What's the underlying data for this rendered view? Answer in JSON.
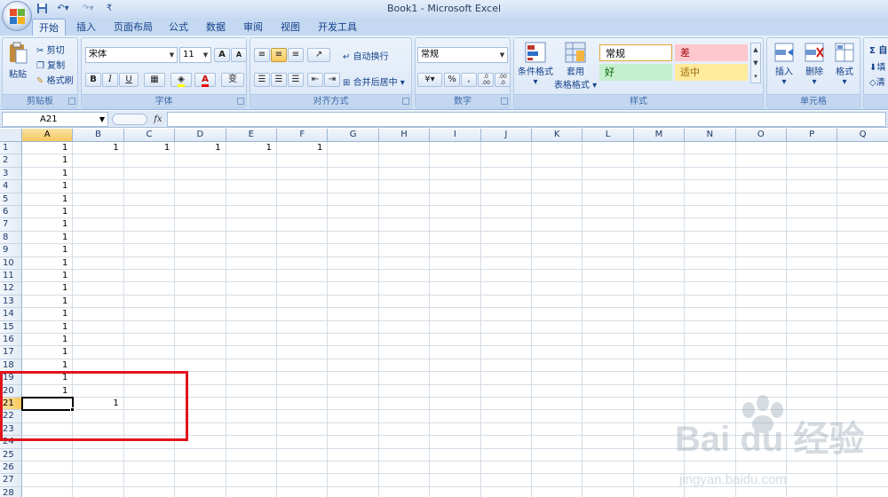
{
  "window": {
    "title": "Book1 - Microsoft Excel"
  },
  "qat": [
    "save-icon",
    "undo-icon",
    "redo-icon",
    "customize-icon"
  ],
  "tabs": [
    "开始",
    "插入",
    "页面布局",
    "公式",
    "数据",
    "审阅",
    "视图",
    "开发工具"
  ],
  "active_tab": "开始",
  "ribbon": {
    "clipboard": {
      "label": "剪贴板",
      "paste": "粘贴",
      "cut": "剪切",
      "copy": "复制",
      "format_painter": "格式刷"
    },
    "font": {
      "label": "字体",
      "font_name": "宋体",
      "font_size": "11",
      "bold": "B",
      "italic": "I",
      "underline": "U",
      "grow": "A",
      "shrink": "A",
      "phonetic": "变",
      "font_color": "A"
    },
    "alignment": {
      "label": "对齐方式",
      "wrap_text": "自动换行",
      "merge_center": "合并后居中"
    },
    "number": {
      "label": "数字",
      "format": "常规",
      "percent": "%",
      "comma": ",",
      "inc_decimal": ".0 .00",
      "dec_decimal": ".00 .0"
    },
    "styles": {
      "label": "样式",
      "conditional": "条件格式",
      "table_line1": "套用",
      "table_line2": "表格格式",
      "cell_normal": "常规",
      "cell_bad": "差",
      "cell_good": "好",
      "cell_neutral": "适中"
    },
    "cells": {
      "label": "单元格",
      "insert": "插入",
      "delete": "删除",
      "format": "格式"
    },
    "editing": {
      "sum": "Σ 自",
      "fill": "填",
      "clear": "清"
    }
  },
  "formula_bar": {
    "name_box": "A21",
    "fx": "fx",
    "formula": ""
  },
  "grid": {
    "columns": [
      "A",
      "B",
      "C",
      "D",
      "E",
      "F",
      "G",
      "H",
      "I",
      "J",
      "K",
      "L",
      "M",
      "N",
      "O",
      "P",
      "Q"
    ],
    "rows": [
      "1",
      "2",
      "3",
      "4",
      "5",
      "6",
      "7",
      "8",
      "9",
      "10",
      "11",
      "12",
      "13",
      "14",
      "15",
      "16",
      "17",
      "18",
      "19",
      "20",
      "21",
      "22",
      "23",
      "24",
      "25",
      "26",
      "27",
      "28"
    ],
    "selected_cell": "A21",
    "cells": [
      {
        "ref": "A1",
        "value": "1"
      },
      {
        "ref": "B1",
        "value": "1"
      },
      {
        "ref": "C1",
        "value": "1"
      },
      {
        "ref": "D1",
        "value": "1"
      },
      {
        "ref": "E1",
        "value": "1"
      },
      {
        "ref": "F1",
        "value": "1"
      },
      {
        "ref": "A2",
        "value": "1"
      },
      {
        "ref": "A3",
        "value": "1"
      },
      {
        "ref": "A4",
        "value": "1"
      },
      {
        "ref": "A5",
        "value": "1"
      },
      {
        "ref": "A6",
        "value": "1"
      },
      {
        "ref": "A7",
        "value": "1"
      },
      {
        "ref": "A8",
        "value": "1"
      },
      {
        "ref": "A9",
        "value": "1"
      },
      {
        "ref": "A10",
        "value": "1"
      },
      {
        "ref": "A11",
        "value": "1"
      },
      {
        "ref": "A12",
        "value": "1"
      },
      {
        "ref": "A13",
        "value": "1"
      },
      {
        "ref": "A14",
        "value": "1"
      },
      {
        "ref": "A15",
        "value": "1"
      },
      {
        "ref": "A16",
        "value": "1"
      },
      {
        "ref": "A17",
        "value": "1"
      },
      {
        "ref": "A18",
        "value": "1"
      },
      {
        "ref": "A19",
        "value": "1"
      },
      {
        "ref": "A20",
        "value": "1"
      },
      {
        "ref": "B21",
        "value": "1"
      }
    ]
  },
  "watermark": {
    "brand": "Bai du 经验",
    "url": "jingyan.baidu.com"
  },
  "colors": {
    "annotation": "#e1141c",
    "ribbon_bg": "#dbe7f6",
    "selected_header": "#f7c75d"
  }
}
